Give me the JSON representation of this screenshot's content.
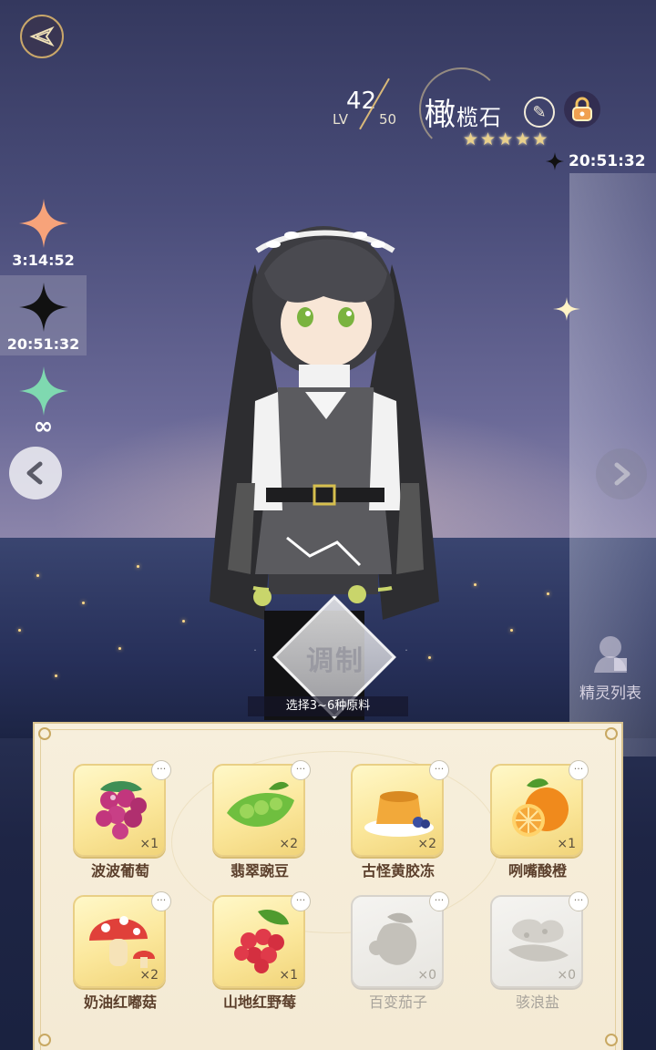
{
  "character": {
    "level_label": "LV",
    "level": "42",
    "max_level": "50",
    "name_large": "橄",
    "name_rest": "榄石",
    "stars": [
      "★",
      "★",
      "★",
      "★",
      "★"
    ]
  },
  "timers": {
    "top": "20:51:32",
    "slots": [
      {
        "time": "3:14:52",
        "color": "#f7a37a",
        "icon": "orange-star-icon"
      },
      {
        "time": "20:51:32",
        "color": "#111111",
        "icon": "black-star-icon"
      },
      {
        "time": "∞",
        "color": "#7fd9b0",
        "icon": "green-star-icon"
      }
    ]
  },
  "sidebar": {
    "elf_list_label": "精灵列表"
  },
  "craft": {
    "button_label": "调制",
    "hint": "选择3~6种原料"
  },
  "ingredients": [
    {
      "name": "波波葡萄",
      "qty": "×1",
      "available": true,
      "icon": "grape-icon"
    },
    {
      "name": "翡翠豌豆",
      "qty": "×2",
      "available": true,
      "icon": "pea-icon"
    },
    {
      "name": "古怪黄胶冻",
      "qty": "×2",
      "available": true,
      "icon": "jelly-icon"
    },
    {
      "name": "咧嘴酸橙",
      "qty": "×1",
      "available": true,
      "icon": "orange-icon"
    },
    {
      "name": "奶油红嘟菇",
      "qty": "×2",
      "available": true,
      "icon": "mushroom-icon"
    },
    {
      "name": "山地红野莓",
      "qty": "×1",
      "available": true,
      "icon": "raspberry-icon"
    },
    {
      "name": "百变茄子",
      "qty": "×0",
      "available": false,
      "icon": "eggplant-icon"
    },
    {
      "name": "骇浪盐",
      "qty": "×0",
      "available": false,
      "icon": "salt-icon"
    }
  ],
  "more_glyph": "···"
}
